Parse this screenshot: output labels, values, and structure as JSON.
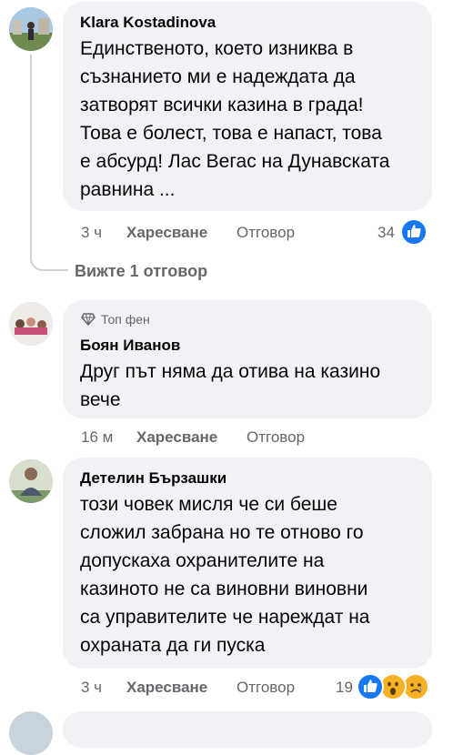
{
  "comments": [
    {
      "author": "Klara Kostadinova",
      "text_lines": [
        "Единственото, което изниква в",
        "съзнанието ми е надеждата да",
        "затворят всички казина в града!",
        "Това е болест, това е напаст, това",
        "е абсурд! Лас Вегас на Дунавската",
        "равнина ..."
      ],
      "time": "3 ч",
      "like_label": "Харесване",
      "reply_label": "Отговор",
      "reaction_count": "34",
      "reactions": [
        "like-icon"
      ],
      "view_replies": "Вижте 1 отговор"
    },
    {
      "badge": "Топ фен",
      "badge_icon": "diamond-icon",
      "author": "Боян Иванов",
      "text_lines": [
        "Друг път няма да отива на казино",
        "вече"
      ],
      "time": "16 м",
      "like_label": "Харесване",
      "reply_label": "Отговор"
    },
    {
      "author": "Детелин Бързашки",
      "text_lines": [
        "този човек мисля че си беше",
        "сложил забрана но те отново го",
        "допускаха охранителите на",
        "казиното не са виновни виновни",
        "са управителите че нареждат на",
        "охраната да ги пуска"
      ],
      "time": "3 ч",
      "like_label": "Харесване",
      "reply_label": "Отговор",
      "reaction_count": "19",
      "reactions": [
        "like-icon",
        "wow-icon",
        "sad-icon"
      ]
    }
  ],
  "colors": {
    "bubble": "#f0f2f5",
    "meta_text": "#65676b",
    "like_blue": "#1877f2",
    "reaction_yellow": "#f7b125"
  }
}
